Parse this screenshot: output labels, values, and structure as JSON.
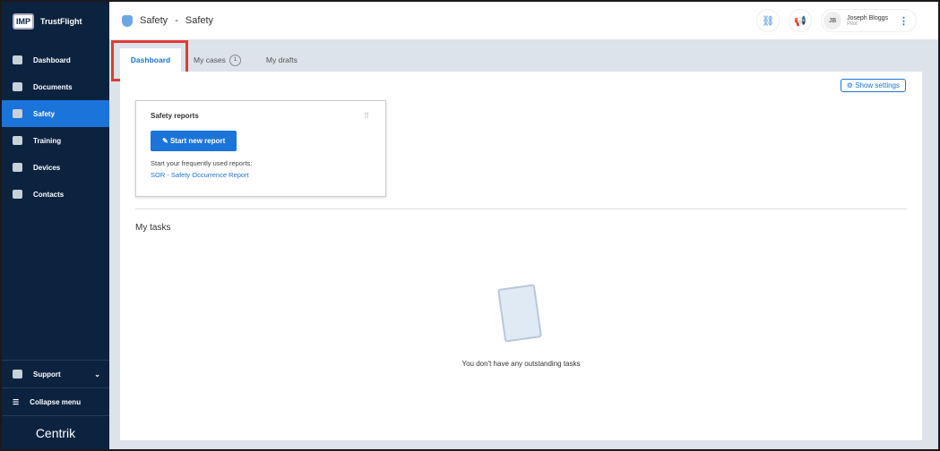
{
  "brand": {
    "logo": "IMP",
    "name": "TrustFlight",
    "footer": "Centrik"
  },
  "sidebar": {
    "items": [
      {
        "label": "Dashboard"
      },
      {
        "label": "Documents"
      },
      {
        "label": "Safety"
      },
      {
        "label": "Training"
      },
      {
        "label": "Devices"
      },
      {
        "label": "Contacts"
      }
    ],
    "support": "Support",
    "collapse": "Collapse menu"
  },
  "header": {
    "title": "Safety",
    "sep": "-",
    "subtitle": "Safety",
    "user": {
      "initials": "JB",
      "name": "Joseph Bloggs",
      "role": "Pilot"
    }
  },
  "tabs": [
    {
      "label": "Dashboard"
    },
    {
      "label": "My cases",
      "badge": "1"
    },
    {
      "label": "My drafts"
    }
  ],
  "main": {
    "show_settings": "Show settings",
    "card": {
      "title": "Safety reports",
      "button": "Start new report",
      "hint": "Start your frequently used reports:",
      "link": "SOR - Safety Occurrence Report"
    },
    "tasks_title": "My tasks",
    "empty": "You don't have any outstanding tasks"
  }
}
